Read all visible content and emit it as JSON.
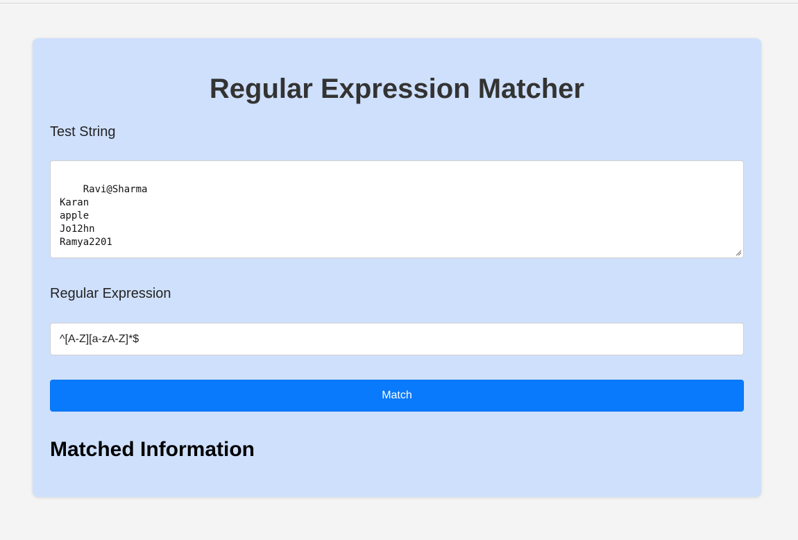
{
  "page": {
    "title": "Regular Expression Matcher"
  },
  "form": {
    "test_string_label": "Test String",
    "test_string_value": "Ravi@Sharma\nKaran\napple\nJo12hn\nRamya2201",
    "regex_label": "Regular Expression",
    "regex_value": "^[A-Z][a-zA-Z]*$",
    "match_button_label": "Match"
  },
  "results": {
    "heading": "Matched Information"
  },
  "colors": {
    "page_background": "#f4f4f4",
    "card_background": "#cfe0fc",
    "button_background": "#0a7afc",
    "button_text": "#ffffff",
    "title_text": "#333333"
  }
}
